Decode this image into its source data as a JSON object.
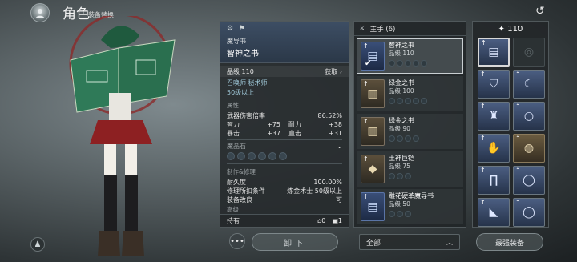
{
  "header": {
    "title": "角色",
    "subtitle": "装备替换"
  },
  "detail": {
    "item_type": "魔导书",
    "item_name": "智神之书",
    "grade_label": "品级 110",
    "acquire_label": "获取",
    "class_line": "召唤师  秘术师",
    "level_line": "50级以上",
    "attributes_label": "属性",
    "stats": {
      "weapon_dmg_label": "武器伤害倍率",
      "weapon_dmg_value": "86.52%",
      "int_label": "智力",
      "int_value": "+75",
      "sta_label": "耐力",
      "sta_value": "+38",
      "crit_label": "暴击",
      "crit_value": "+37",
      "hit_label": "直击",
      "hit_value": "+31"
    },
    "magic_stone_label": "魔晶石",
    "craft_label": "制作&修理",
    "durability_label": "耐久度",
    "durability_value": "100.00%",
    "repair_label": "修理所扣条件",
    "repair_value": "炼金术士 50级以上",
    "reforge_label": "装备改良",
    "reforge_value": "可",
    "more_label": "高级",
    "owned_label": "持有",
    "owned_count_1": "0",
    "owned_count_2": "1"
  },
  "buttons": {
    "unequip": "卸下",
    "more": "•••",
    "best_gear": "最强装备"
  },
  "list": {
    "header": "主手 (6)",
    "items": [
      {
        "name": "智神之书",
        "grade": "品级 110"
      },
      {
        "name": "绿金之书",
        "grade": "品级 100"
      },
      {
        "name": "绿金之书",
        "grade": "品级 90"
      },
      {
        "name": "土神巨铠",
        "grade": "品级 75"
      },
      {
        "name": "雕花硬革魔导书",
        "grade": "品级 50"
      }
    ],
    "filter_value": "全部"
  },
  "equip": {
    "power": "110"
  },
  "icons": {
    "back": "back-arrow-icon",
    "sword": "sword-icon",
    "check": "check-icon"
  }
}
